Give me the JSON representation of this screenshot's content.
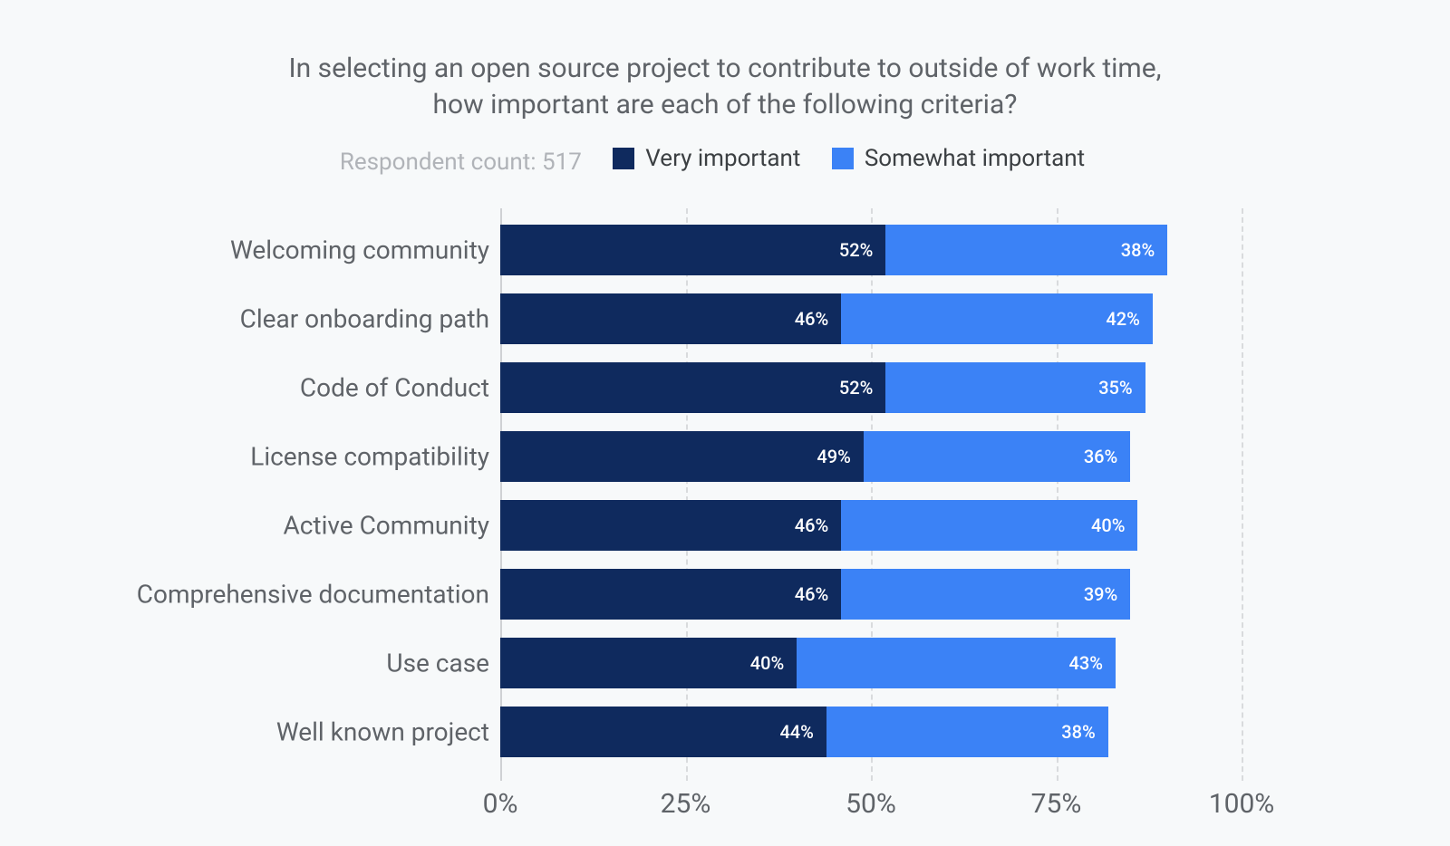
{
  "chart_data": {
    "type": "bar",
    "orientation": "horizontal",
    "stacked": true,
    "title": "In selecting an open source project to contribute to outside of work time,\nhow important are each of the following criteria?",
    "respondent_label": "Respondent count: 517",
    "xlabel": "",
    "ylabel": "",
    "xlim": [
      0,
      100
    ],
    "x_ticks": [
      0,
      25,
      50,
      75,
      100
    ],
    "x_tick_labels": [
      "0%",
      "25%",
      "50%",
      "75%",
      "100%"
    ],
    "categories": [
      "Welcoming community",
      "Clear onboarding path",
      "Code of Conduct",
      "License compatibility",
      "Active Community",
      "Comprehensive documentation",
      "Use case",
      "Well known project"
    ],
    "series": [
      {
        "name": "Very important",
        "color": "#0f2a5e",
        "values": [
          52,
          46,
          52,
          49,
          46,
          46,
          40,
          44
        ]
      },
      {
        "name": "Somewhat important",
        "color": "#3b82f6",
        "values": [
          38,
          42,
          35,
          36,
          40,
          39,
          43,
          38
        ]
      }
    ],
    "value_suffix": "%"
  }
}
